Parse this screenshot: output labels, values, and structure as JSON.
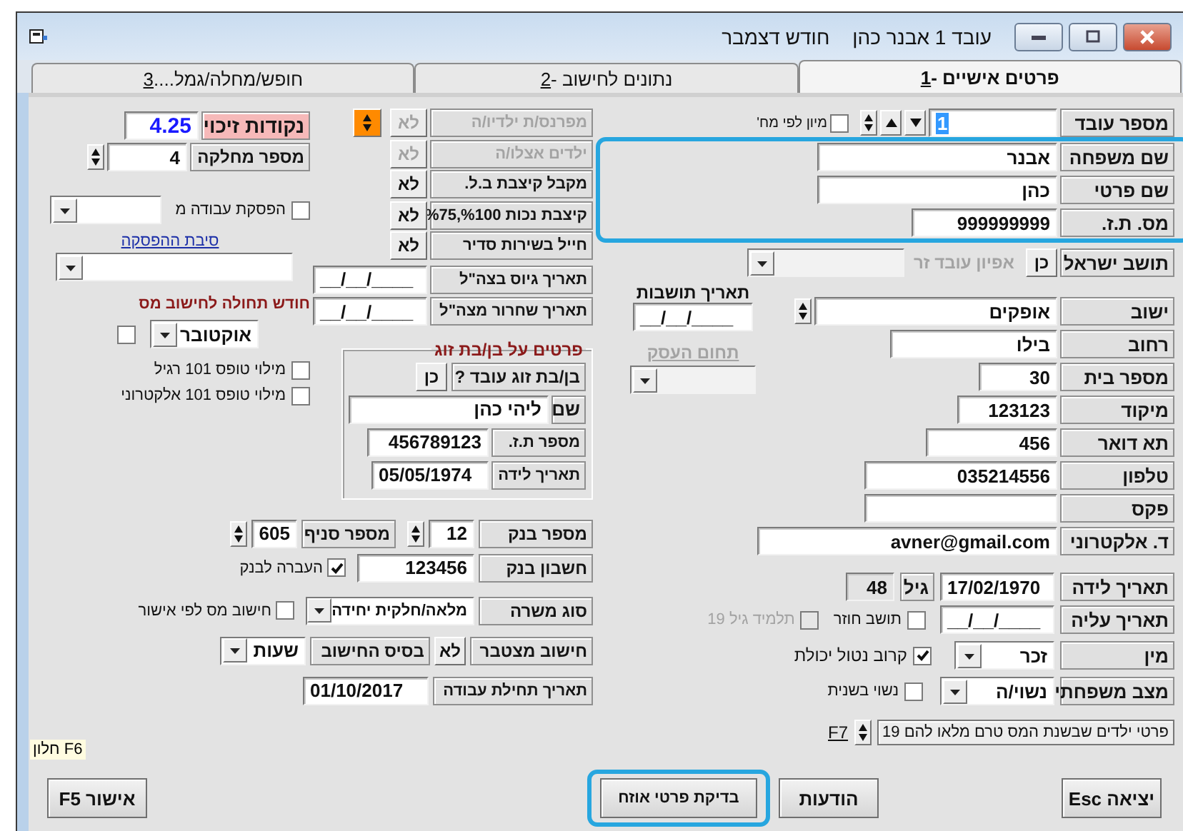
{
  "window": {
    "title": "עובד 1 אבנר כהן",
    "period": "חודש דצמבר"
  },
  "tabs": [
    {
      "label": "פרטים אישיים - ",
      "hotkey": "1",
      "selected": true
    },
    {
      "label": "נתונים לחישוב - ",
      "hotkey": "2",
      "selected": false
    },
    {
      "label": "חופש/מחלה/גמל....",
      "hotkey": "3",
      "selected": false
    }
  ],
  "employee": {
    "label": "מספר עובד",
    "value": "1",
    "sort_label": "מיון לפי מח'",
    "sort_checked": false
  },
  "name_group": {
    "highlighted": true,
    "fields": [
      {
        "label": "שם משפחה",
        "value": "אבנר",
        "kind": "name"
      },
      {
        "label": "שם פרטי",
        "value": "כהן",
        "kind": "name"
      },
      {
        "label": "מס. ת.ז.",
        "value": "999999999",
        "kind": "id"
      }
    ]
  },
  "residency": {
    "label": "תושב ישראל",
    "value": "כן",
    "foreign_label": "אפיון עובד זר",
    "foreign_disabled": true
  },
  "residency_date": {
    "label": "תאריך תושבות",
    "value": "__/__/____"
  },
  "business": {
    "label": "תחום העסק",
    "disabled": true
  },
  "address": [
    {
      "label": "ישוב",
      "value": "אופקים",
      "kind": "spin"
    },
    {
      "label": "רחוב",
      "value": "בילו",
      "kind": "text"
    },
    {
      "label": "מספר בית",
      "value": "30",
      "kind": "text"
    },
    {
      "label": "מיקוד",
      "value": "123123",
      "kind": "text"
    }
  ],
  "contact": [
    {
      "label": "תא דואר",
      "value": "456"
    },
    {
      "label": "טלפון",
      "value": "035214556"
    },
    {
      "label": "פקס"
    },
    {
      "label": "ד. אלקטרוני",
      "value": "avner@gmail.com"
    }
  ],
  "birth": {
    "label": "תאריך לידה",
    "value": "17/02/1970",
    "age_label": "גיל",
    "age": "48"
  },
  "aliyah": {
    "label": "תאריך עליה",
    "value": "__/__/____",
    "checks": [
      {
        "label": "תושב חוזר",
        "checked": false,
        "disabled": false
      },
      {
        "label": "תלמיד גיל 19",
        "checked": false,
        "disabled": true
      }
    ]
  },
  "gender": {
    "label": "מין",
    "value": "זכר",
    "check_label": "קרוב נטול יכולת",
    "checked": true
  },
  "marital": {
    "label": "מצב משפחתי",
    "value": "נשוי/ה",
    "check_label": "נשוי בשנית",
    "checked": false
  },
  "children": {
    "label": "פרטי ילדים שבשנת המס טרם מלאו להם 19",
    "hotkey": "F7"
  },
  "flags": [
    {
      "label": "מפרנס/ת ילדיו/ה",
      "value": "לא",
      "disabled": true
    },
    {
      "label": "ילדים אצלו/ה",
      "value": "לא",
      "disabled": true
    },
    {
      "label": "מקבל קיצבת ב.ל.",
      "value": "לא",
      "disabled": false
    },
    {
      "label": "קיצבת נכות %100,%75",
      "value": "לא",
      "disabled": false
    },
    {
      "label": "חייל בשירות סדיר",
      "value": "לא",
      "disabled": false
    }
  ],
  "army_dates": [
    {
      "label": "תאריך גיוס בצה\"ל",
      "value": "__/__/____"
    },
    {
      "label": "תאריך שחרור מצה\"ל",
      "value": "__/__/____"
    }
  ],
  "spouse": {
    "title": "פרטים על בן/בת זוג",
    "works_label": "בן/בת זוג עובד ?",
    "works": "כן",
    "name_label": "שם",
    "name": "ליהי כהן",
    "id_label": "מספר ת.ז.",
    "id": "456789123",
    "birth_label": "תאריך לידה",
    "birth": "05/05/1974"
  },
  "credit_points": {
    "label": "נקודות זיכוי",
    "value": "4.25"
  },
  "department": {
    "label": "מספר מחלקה",
    "value": "4"
  },
  "stop_work": {
    "label": "הפסקת עבודה מ",
    "checked": false
  },
  "stop_reason": {
    "label": "סיבת ההפסקה"
  },
  "tax_month": {
    "label": "חודש תחולה לחישוב מס",
    "value": "אוקטובר",
    "checked": false
  },
  "form101": [
    {
      "label": "מילוי טופס 101 רגיל",
      "checked": false
    },
    {
      "label": "מילוי טופס 101 אלקטרוני",
      "checked": false
    }
  ],
  "bank": {
    "bank_label": "מספר בנק",
    "bank": "12",
    "branch_label": "מספר סניף",
    "branch": "605",
    "account_label": "חשבון בנק",
    "account": "123456",
    "transfer_label": "העברה לבנק",
    "transfer_checked": true
  },
  "job": {
    "label": "סוג משרה",
    "value": "מלאה/חלקית יחידה",
    "tax_check_label": "חישוב מס לפי אישור",
    "tax_checked": false
  },
  "cumulative": {
    "label": "חישוב מצטבר",
    "value": "לא",
    "basis_label": "בסיס החישוב",
    "basis": "שעות"
  },
  "start_date": {
    "label": "תאריך תחילת עבודה",
    "value": "01/10/2017"
  },
  "window_hint": "F6 חלון",
  "buttons": [
    {
      "label": "יציאה Esc",
      "kind": "exit",
      "highlighted": false
    },
    {
      "label": "הודעות",
      "kind": "messages",
      "highlighted": false
    },
    {
      "label": "בדיקת פרטי אוזח",
      "kind": "check",
      "highlighted": true
    },
    {
      "label": "אישור F5",
      "kind": "confirm",
      "highlighted": false
    }
  ]
}
